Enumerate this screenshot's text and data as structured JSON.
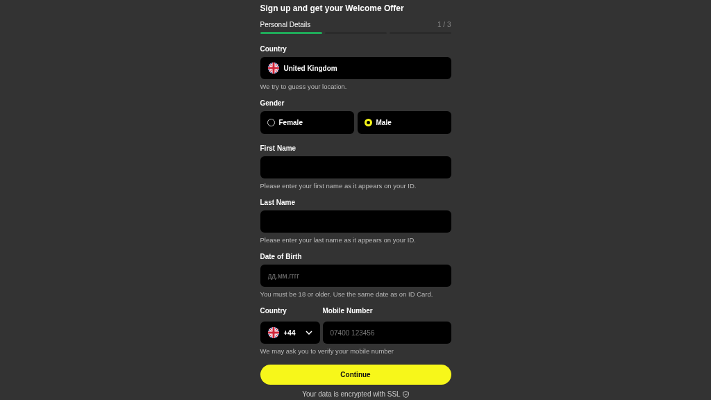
{
  "title": "Sign up and get your Welcome Offer",
  "progress": {
    "label": "Personal Details",
    "count": "1 / 3",
    "steps": [
      {
        "done": true
      },
      {
        "done": false
      },
      {
        "done": false
      }
    ]
  },
  "country": {
    "label": "Country",
    "value": "United Kingdom",
    "hint": "We try to guess your location."
  },
  "gender": {
    "label": "Gender",
    "options": [
      {
        "label": "Female",
        "selected": false
      },
      {
        "label": "Male",
        "selected": true
      }
    ]
  },
  "fields": [
    {
      "label": "First Name",
      "hint": "Please enter your first name as it appears on your ID."
    },
    {
      "label": "Last Name",
      "hint": "Please enter your last name as it appears on your ID."
    },
    {
      "label": "Date of Birth",
      "placeholder": "дд.мм.гггг",
      "hint": "You must be 18 or older. Use the same date as on ID Card."
    }
  ],
  "phone": {
    "country_label": "Country",
    "code": "+44",
    "number_label": "Mobile Number",
    "placeholder": "07400 123456",
    "hint": "We may ask you to verify your mobile number"
  },
  "button": "Continue",
  "footer": "Your data is encrypted with SSL"
}
